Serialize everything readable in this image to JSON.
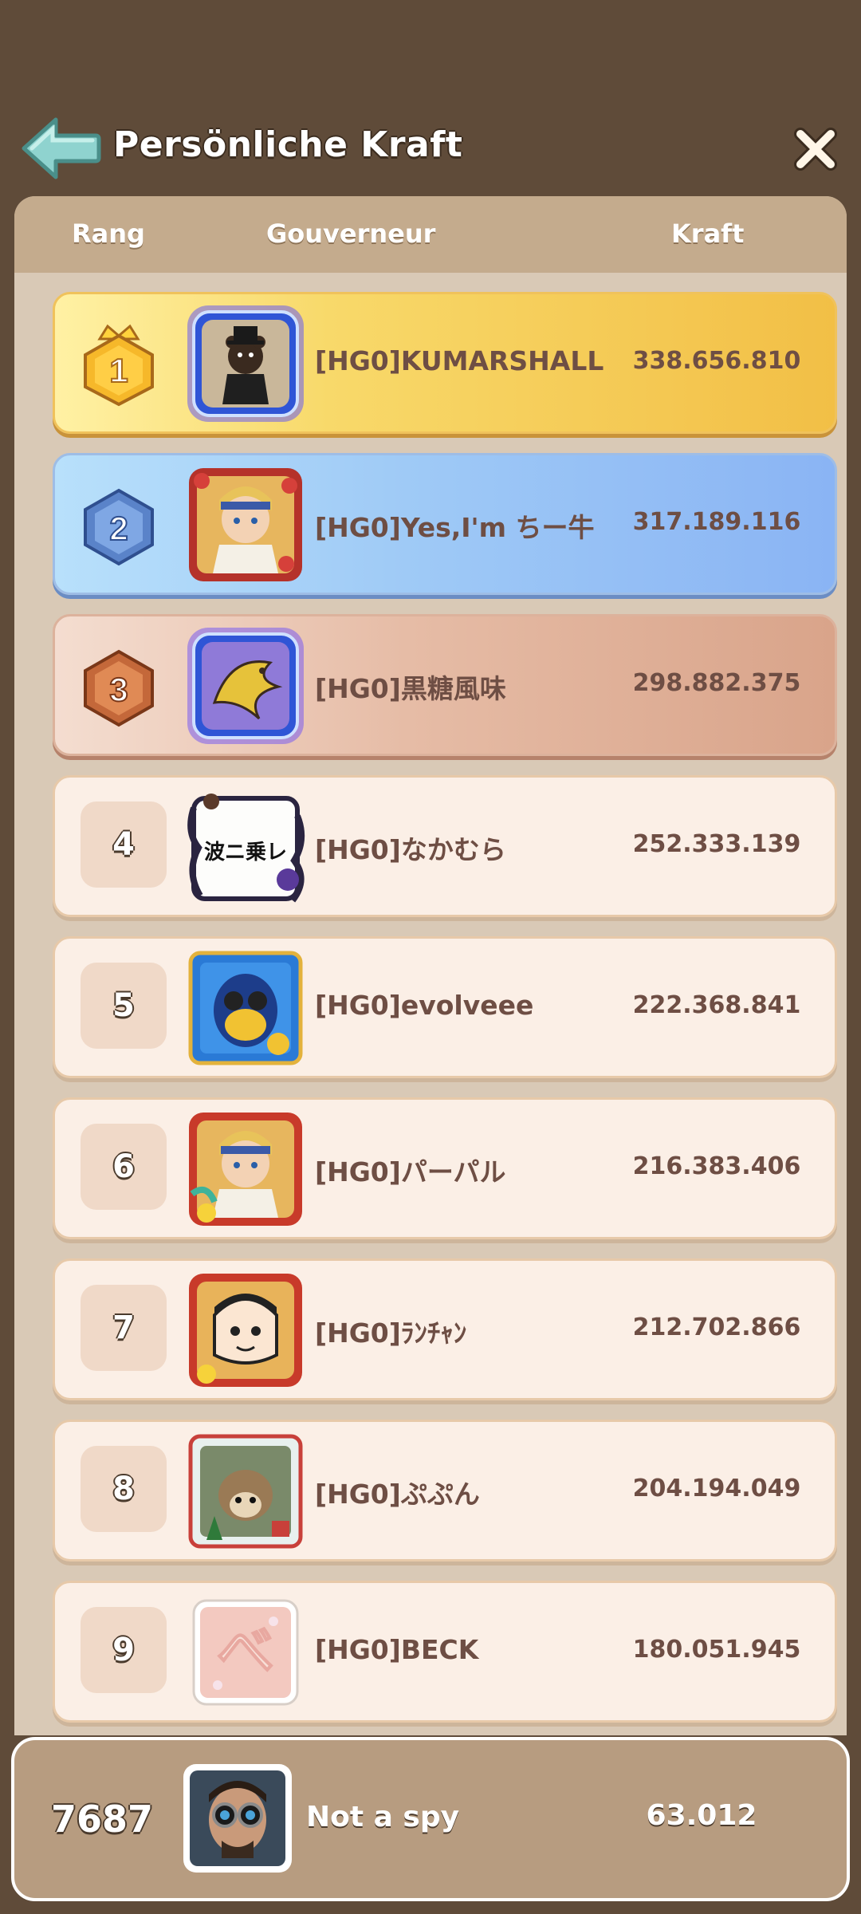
{
  "header": {
    "title": "Persönliche Kraft",
    "back_icon": "back-arrow-icon",
    "close_icon": "close-icon",
    "accent": "#8fd3cf"
  },
  "columns": {
    "rank": "Rang",
    "governor": "Gouverneur",
    "power": "Kraft"
  },
  "rows": [
    {
      "rank": "1",
      "name": "[HG0]KUMARSHALL",
      "power": "338.656.810",
      "style": "gold",
      "avatar": "bear-gentleman-avatar"
    },
    {
      "rank": "2",
      "name": "[HG0]Yes,I'm ちー牛",
      "power": "317.189.116",
      "style": "blue",
      "avatar": "blonde-hero-avatar"
    },
    {
      "rank": "3",
      "name": "[HG0]黒糖風味",
      "power": "298.882.375",
      "style": "bronze",
      "avatar": "golden-dragon-avatar"
    },
    {
      "rank": "4",
      "name": "[HG0]なかむら",
      "power": "252.333.139",
      "style": "plain",
      "avatar": "calligraphy-avatar",
      "avatar_text": "波ニ乗レ"
    },
    {
      "rank": "5",
      "name": "[HG0]evolveee",
      "power": "222.368.841",
      "style": "plain",
      "avatar": "penguin-robot-avatar"
    },
    {
      "rank": "6",
      "name": "[HG0]パーパル",
      "power": "216.383.406",
      "style": "plain",
      "avatar": "blonde-hero-avatar"
    },
    {
      "rank": "7",
      "name": "[HG0]ﾗﾝﾁｬﾝ",
      "power": "212.702.866",
      "style": "plain",
      "avatar": "cartoon-boy-avatar"
    },
    {
      "rank": "8",
      "name": "[HG0]ぷぷん",
      "power": "204.194.049",
      "style": "plain",
      "avatar": "hedgehog-avatar"
    },
    {
      "rank": "9",
      "name": "[HG0]BECK",
      "power": "180.051.945",
      "style": "plain",
      "avatar": "pink-letter-avatar",
      "avatar_text": "べ"
    }
  ],
  "self": {
    "rank": "7687",
    "name": "Not a spy",
    "power": "63.012",
    "avatar": "goggles-man-avatar"
  }
}
